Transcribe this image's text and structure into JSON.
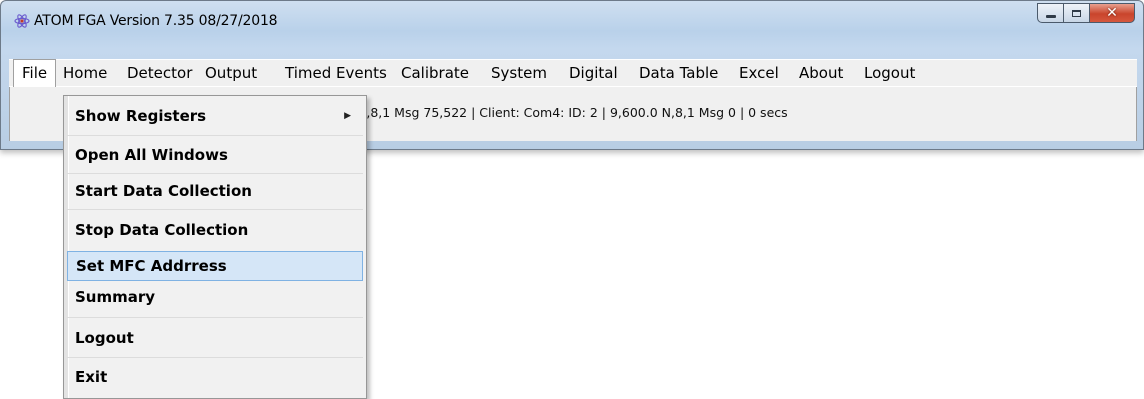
{
  "window": {
    "title": "ATOM  FGA  Version 7.35  08/27/2018",
    "app_icon": "atom-icon",
    "controls": {
      "minimize": "minimize-icon",
      "maximize": "maximize-icon",
      "close": "close-icon"
    }
  },
  "menubar": {
    "items": [
      "File",
      "Home",
      "Detector",
      "Output",
      "Timed Events",
      "Calibrate",
      "System",
      "Digital",
      "Data Table",
      "Excel",
      "About",
      "Logout"
    ],
    "active": "File"
  },
  "status": {
    "text": "N,8,1 Msg  75,522 | Client: Com4: ID: 2 | 9,600.0 N,8,1 Msg 0 | 0 secs"
  },
  "file_menu": {
    "items": [
      "Show Registers",
      "Open All Windows",
      "Start Data Collection",
      "Stop Data Collection",
      "Set MFC Addrress",
      "Summary",
      "Logout",
      "Exit"
    ],
    "highlighted": "Set MFC Addrress",
    "submenu_item": "Show Registers"
  },
  "colors": {
    "highlight_bg": "#d5e6f7",
    "highlight_border": "#7fb2e3",
    "close_button": "#c9452c",
    "icon": "#6a5acd"
  }
}
